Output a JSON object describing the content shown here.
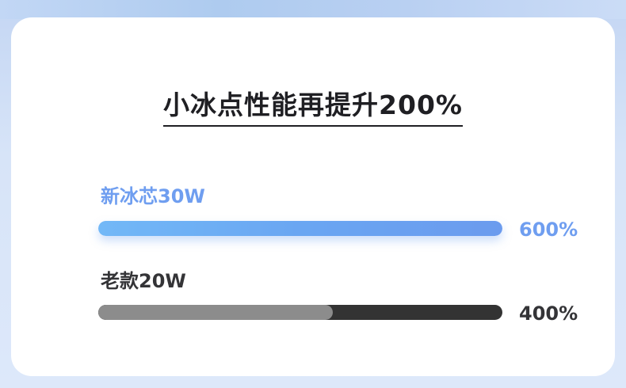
{
  "title": "小冰点性能再提升200%",
  "bars": [
    {
      "label": "新冰芯30W",
      "value_text": "600%",
      "fill_fraction": 1.0,
      "color": "#6f9ef0"
    },
    {
      "label": "老款20W",
      "value_text": "400%",
      "fill_fraction": 0.58,
      "color": "#8c8c8c"
    }
  ]
}
